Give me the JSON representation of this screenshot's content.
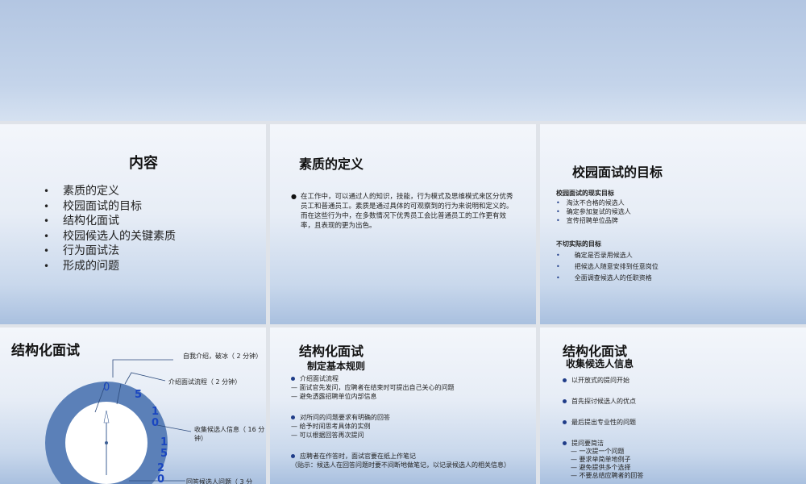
{
  "slides": {
    "contents": {
      "title": "内容",
      "items": [
        "素质的定义",
        "校园面试的目标",
        "结构化面试",
        "校园候选人的关键素质",
        "行为面试法",
        "形成的问题"
      ]
    },
    "definition": {
      "title": "素质的定义",
      "body": "在工作中，可以通过人的知识，技能，行为模式及思维模式来区分优秀员工和普通员工。素质是通过具体的可观察到的行为来说明和定义的。而在这些行为中，在多数情况下优秀员工会比普通员工的工作更有效率，且表现的更为出色。"
    },
    "goals": {
      "title": "校园面试的目标",
      "real_heading": "校园面试的现实目标",
      "real_items": [
        "淘汰不合格的候选人",
        "确定参加复试的候选人",
        "宣传招聘单位品牌"
      ],
      "unreal_heading": "不切实际的目标",
      "unreal_items": [
        "确定是否录用候选人",
        "把候选人随意安排到任意岗位",
        "全面调查候选人的任职资格"
      ]
    },
    "structured_chart": {
      "title": "结构化面试",
      "labels": [
        "自我介绍，破冰（ 2 分钟）",
        "介绍面试流程（ 2 分钟）",
        "收集候选人信息（ 16 分钟）",
        "回答候选人问题（ 3 分"
      ],
      "numbers": [
        "0",
        "5",
        "1\n0",
        "1\n5",
        "2\n0"
      ],
      "colors": {
        "donut": "#5b80b8",
        "numbers": "#1a46c0"
      }
    },
    "rules": {
      "title": "结构化面试",
      "subtitle": "制定基本规则",
      "groups": [
        {
          "head": "介绍面试流程",
          "lines": [
            "— 面试官先发问，应聘者在结束时可提出自己关心的问题",
            "— 避免透露招聘单位内部信息"
          ]
        },
        {
          "head": "对所问的问题要求有明确的回答",
          "lines": [
            "— 给予时间思考具体的实例",
            "— 可以根据回答再次提问"
          ]
        },
        {
          "head": "应聘者在作答时，面试官要在纸上作笔记",
          "lines": [
            "（贴示：候选人在回答问题时要不间断地做笔记，以记录候选人的相关信息）"
          ]
        }
      ]
    },
    "collect": {
      "title": "结构化面试",
      "subtitle": "收集候选人信息",
      "items": [
        "以开放式的提问开始",
        "首先探讨候选人的优点",
        "最后提出专业性的问题",
        "提问要简洁"
      ],
      "sub_items": [
        "— 一次提一个问题",
        "— 要求举简单地例子",
        "— 避免提供多个选择",
        "— 不要总结应聘者的回答"
      ]
    }
  }
}
